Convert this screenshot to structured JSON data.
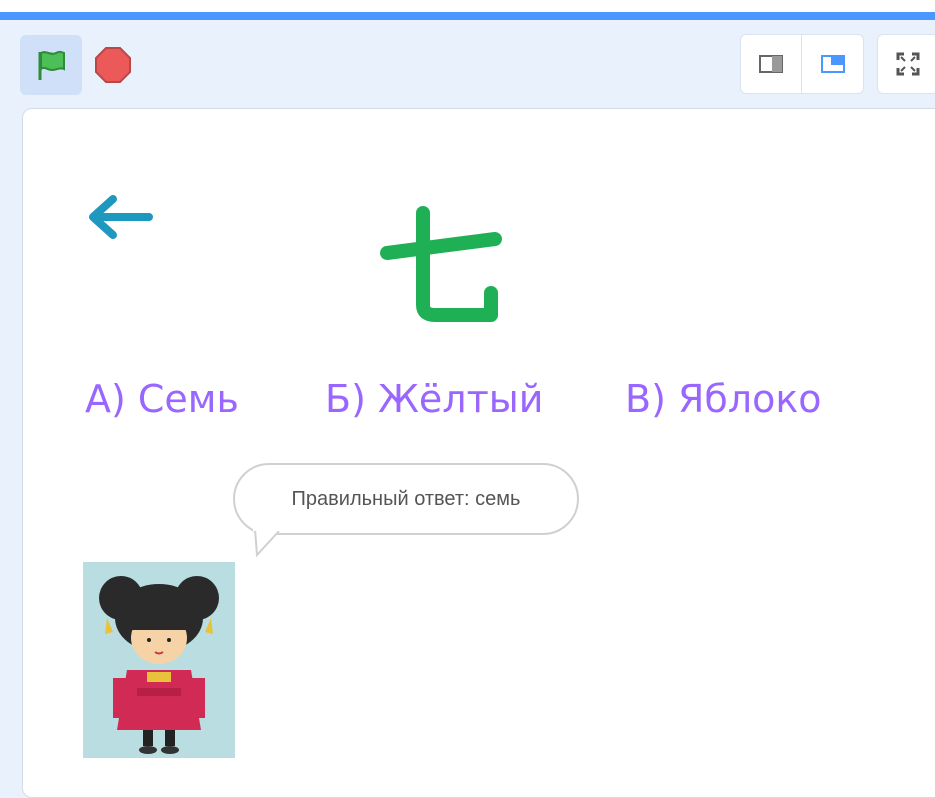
{
  "toolbar": {
    "green_flag": "green-flag-icon",
    "stop": "stop-sign-icon",
    "view_small_stage": "small-stage-icon",
    "view_normal_stage": "normal-stage-icon",
    "fullscreen": "fullscreen-icon"
  },
  "stage": {
    "back_icon": "back-arrow-icon",
    "kana_character": "七",
    "answers": {
      "a": "А) Семь",
      "b": "Б) Жёлтый",
      "c": "В) Яблоко"
    },
    "speech_bubble": "Правильный ответ: семь"
  },
  "colors": {
    "accent_blue": "#4c97ff",
    "answer_purple": "#9966ff",
    "kana_green": "#1faf54",
    "arrow_teal": "#1e98bf"
  }
}
